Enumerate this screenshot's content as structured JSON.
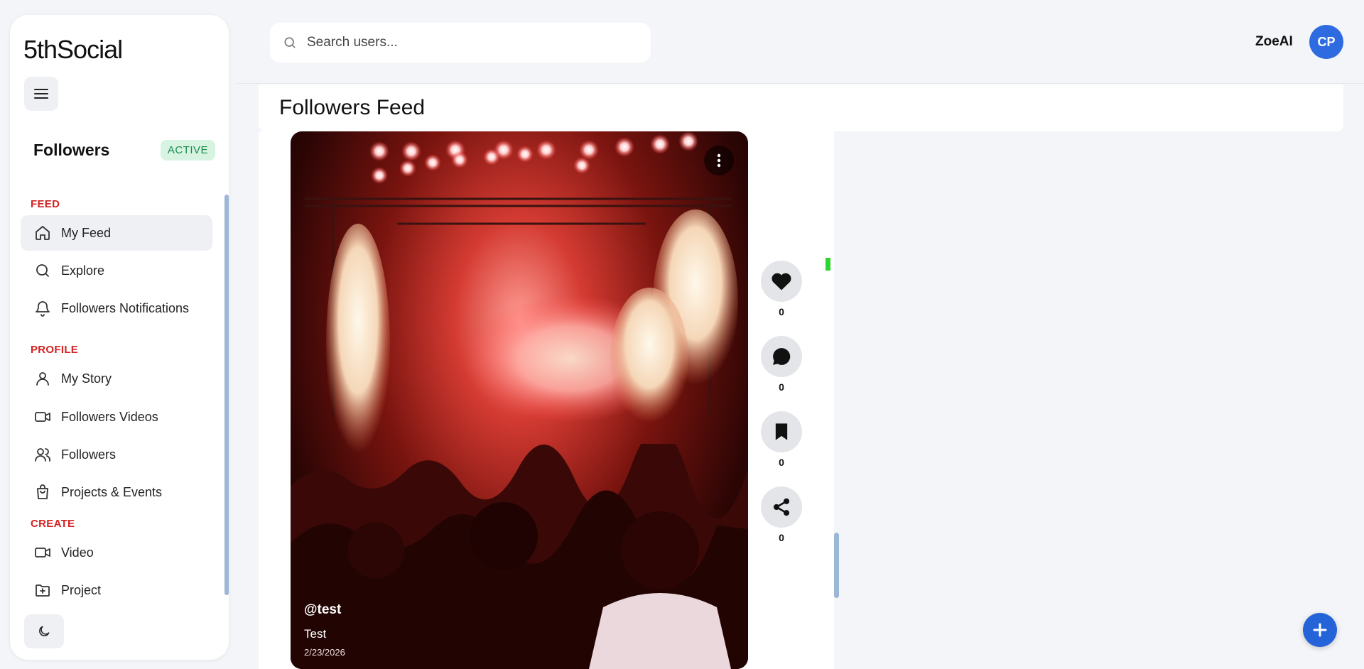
{
  "brand": "5thSocial",
  "search": {
    "placeholder": "Search users..."
  },
  "user": {
    "name": "ZoeAI",
    "initials": "CP"
  },
  "sidebar": {
    "section_title": "Followers",
    "status_badge": "ACTIVE",
    "groups": [
      {
        "label": "FEED",
        "items": [
          {
            "label": "My Feed",
            "icon": "home-icon",
            "active": true
          },
          {
            "label": "Explore",
            "icon": "search-icon"
          },
          {
            "label": "Followers Notifications",
            "icon": "bell-icon"
          }
        ]
      },
      {
        "label": "PROFILE",
        "items": [
          {
            "label": "My Story",
            "icon": "user-icon"
          },
          {
            "label": "Followers Videos",
            "icon": "video-icon"
          },
          {
            "label": "Followers",
            "icon": "users-icon"
          },
          {
            "label": "Projects & Events",
            "icon": "shopping-bag-icon"
          }
        ]
      },
      {
        "label": "CREATE",
        "items": [
          {
            "label": "Video",
            "icon": "video-icon"
          },
          {
            "label": "Project",
            "icon": "folder-plus-icon"
          }
        ]
      }
    ]
  },
  "main": {
    "title": "Followers Feed",
    "post": {
      "username": "@test",
      "caption": "Test",
      "date": "2/23/2026",
      "likes": "0",
      "comments": "0",
      "saves": "0",
      "shares": "0"
    }
  },
  "colors": {
    "accent": "#2563d9",
    "group_label": "#d32222",
    "badge_bg": "#d7f4e3",
    "badge_text": "#1a8a4a"
  }
}
